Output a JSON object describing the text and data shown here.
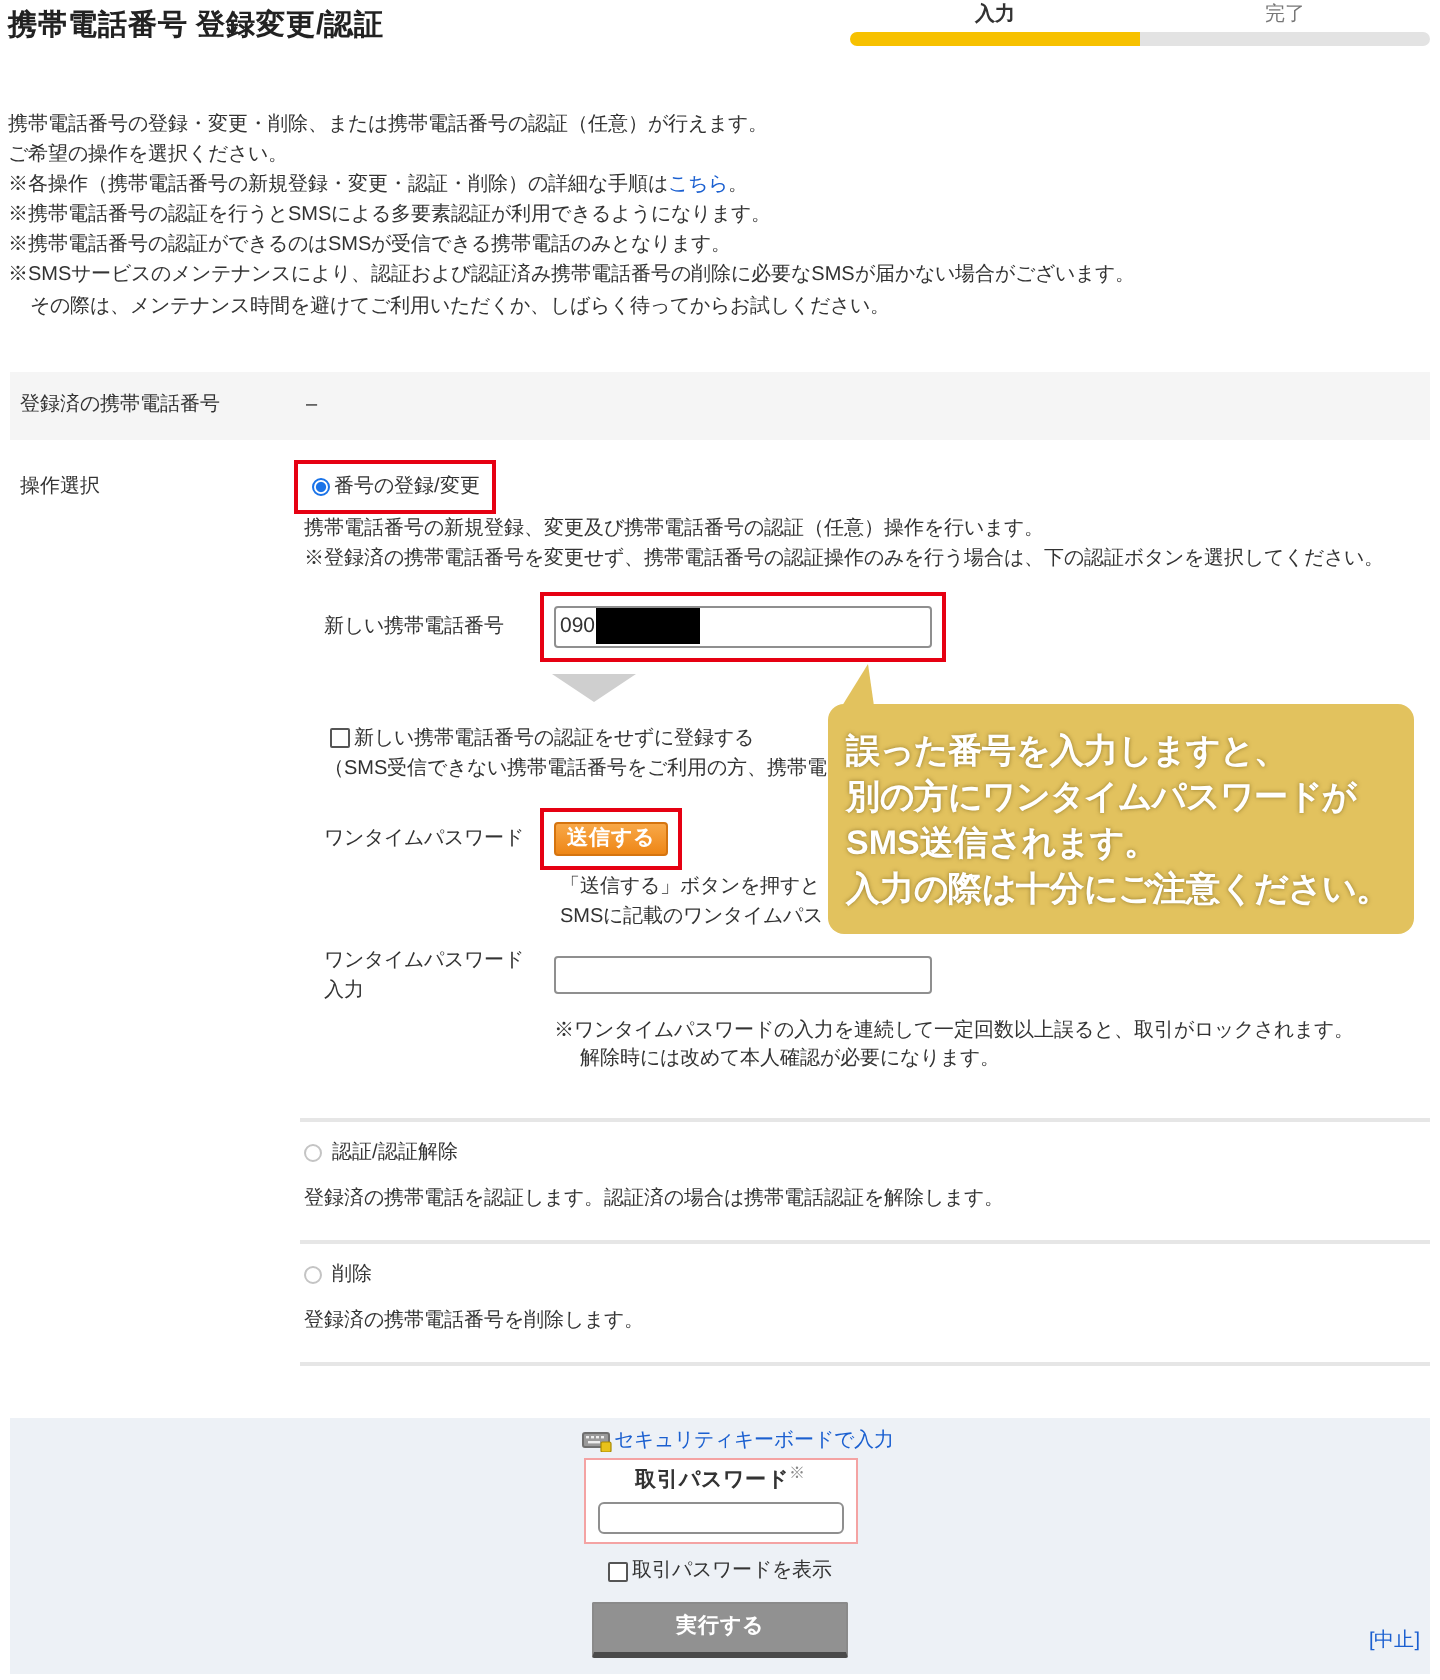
{
  "header": {
    "title": "携帯電話番号 登録変更/認証",
    "steps": [
      {
        "label": "入力",
        "selected": true
      },
      {
        "label": "完了",
        "selected": false
      }
    ]
  },
  "intro": [
    {
      "text": "携帯電話番号の登録・変更・削除、または携帯電話番号の認証（任意）が行えます。",
      "continued": false
    },
    {
      "text": "ご希望の操作を選択ください。",
      "continued": false
    },
    {
      "text": "※各操作（携帯電話番号の新規登録・変更・認証・削除）の詳細な手順は",
      "link": "こちら",
      "after": "。",
      "continued": false
    },
    {
      "text": "※携帯電話番号の認証を行うとSMSによる多要素認証が利用できるようになります。",
      "continued": false
    },
    {
      "text": "※携帯電話番号の認証ができるのはSMSが受信できる携帯電話のみとなります。",
      "continued": false
    },
    {
      "text": "※SMSサービスのメンテナンスにより、認証および認証済み携帯電話番号の削除に必要なSMSが届かない場合がございます。",
      "continued": false
    },
    {
      "text": "その際は、メンテナンス時間を避けてご利用いただくか、しばらく待ってからお試しください。",
      "continued": true
    }
  ],
  "registered_phone": {
    "label": "登録済の携帯電話番号",
    "value": "–"
  },
  "operation": {
    "label": "操作選択",
    "options": [
      {
        "label": "番号の登録/変更",
        "selected": true,
        "highlighted": true,
        "description": [
          "携帯電話番号の新規登録、変更及び携帯電話番号の認証（任意）操作を行います。",
          "※登録済の携帯電話番号を変更せず、携帯電話番号の認証操作のみを行う場合は、下の認証ボタンを選択してください。"
        ],
        "form": {
          "phone": {
            "label": "新しい携帯電話番号",
            "value": "090",
            "redacted": true,
            "highlighted": true
          },
          "skip_verification": {
            "label": "新しい携帯電話番号の認証をせずに登録する",
            "checked": false,
            "note": "（SMS受信できない携帯電話番号をご利用の方、携帯電"
          },
          "otp_send": {
            "label": "ワンタイムパスワード",
            "button": "送信する",
            "highlighted": true,
            "notes": [
              "「送信する」ボタンを押すと",
              "SMSに記載のワンタイムパス"
            ]
          },
          "otp_input": {
            "label": "ワンタイムパスワード入力",
            "notes": [
              {
                "text": "※ワンタイムパスワードの入力を連続して一定回数以上誤ると、取引がロックされます。",
                "continued": false
              },
              {
                "text": "解除時には改めて本人確認が必要になります。",
                "continued": true
              }
            ]
          }
        }
      },
      {
        "label": "認証/認証解除",
        "selected": false,
        "highlighted": false,
        "description": [
          "登録済の携帯電話を認証します。認証済の場合は携帯電話認証を解除します。"
        ]
      },
      {
        "label": "削除",
        "selected": false,
        "highlighted": false,
        "description": [
          "登録済の携帯電話番号を削除します。"
        ]
      }
    ]
  },
  "password_panel": {
    "keyboard_link": "セキュリティキーボードで入力",
    "label": "取引パスワード$^{※}$",
    "show_password": {
      "label": "取引パスワードを表示",
      "checked": false
    },
    "submit": {
      "label": "実行する",
      "disabled": true
    },
    "cancel": "[中止]"
  },
  "callout": {
    "lines": [
      "誤った番号を入力しますと、",
      "別の方にワンタイムパスワードが",
      "SMS送信されます。",
      "入力の際は十分にご注意ください。"
    ]
  }
}
